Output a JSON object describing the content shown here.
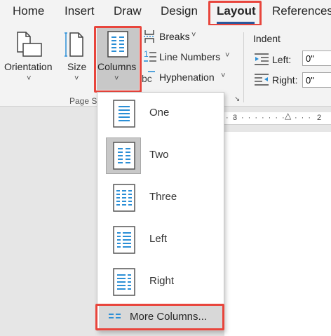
{
  "tabs": {
    "home": "Home",
    "insert": "Insert",
    "draw": "Draw",
    "design": "Design",
    "layout": "Layout",
    "references": "References"
  },
  "ribbon": {
    "orientation_label": "Orientation",
    "size_label": "Size",
    "columns_label": "Columns",
    "breaks_label": "Breaks",
    "line_numbers_label": "Line Numbers",
    "hyphenation_label": "Hyphenation",
    "hyphenation_icon_text": "bc",
    "line_numbers_icon_text": "1",
    "chevron": "˅",
    "group_page_setup": "Page S",
    "indent_title": "Indent",
    "left_label": "Left:",
    "right_label": "Right:",
    "left_value": "0\"",
    "right_value": "0\""
  },
  "ruler": {
    "mark_3": "3",
    "mark_2": "2"
  },
  "columns_menu": {
    "items": [
      {
        "label": "One"
      },
      {
        "label": "Two"
      },
      {
        "label": "Three"
      },
      {
        "label": "Left"
      },
      {
        "label": "Right"
      }
    ],
    "more_label": "More Columns..."
  },
  "colors": {
    "highlight": "#e8453c",
    "accent_blue": "#2b8fd6",
    "selected_bg": "#c8c8c8",
    "tab_underline": "#2b579a"
  }
}
